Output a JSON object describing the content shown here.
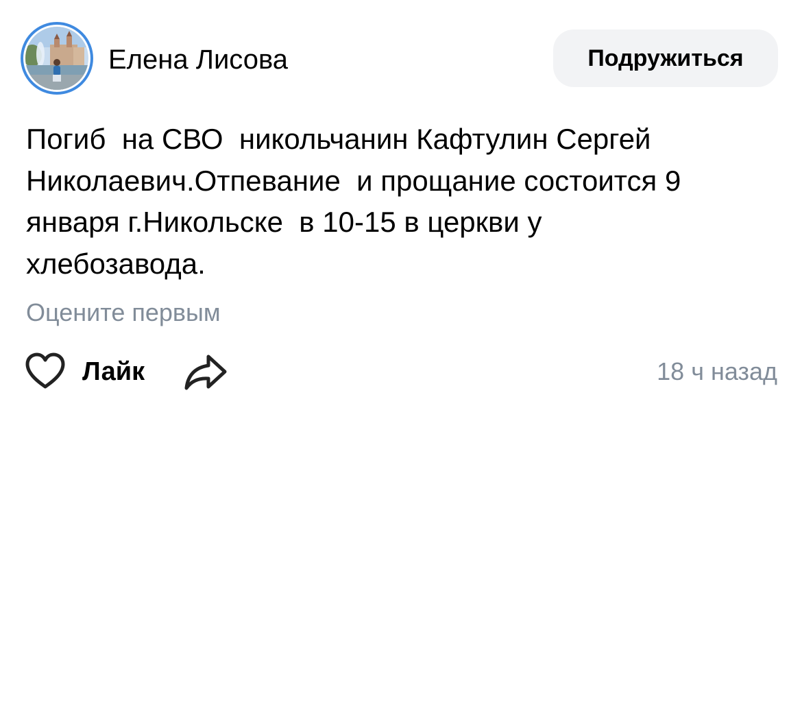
{
  "author": {
    "name": "Елена Лисова",
    "avatar_icon": "user-photo-avatar",
    "avatar_ring_color": "#3f8ae0"
  },
  "header": {
    "befriend_label": "Подружиться"
  },
  "post": {
    "text": "Погиб  на СВО  никольчанин Кафтулин Сергей\nНиколаевич.Отпевание  и прощание состоится 9\nянваря г.Никольске  в 10-15 в церкви у\nхлебозавода.",
    "rate_first_label": "Оцените первым"
  },
  "actions": {
    "like_label": "Лайк",
    "like_icon": "heart-outline-icon",
    "share_icon": "share-arrow-icon",
    "timestamp": "18 ч назад"
  },
  "colors": {
    "text_primary": "#000000",
    "text_secondary": "#818c99",
    "button_bg": "#f2f3f5",
    "accent": "#3f8ae0"
  }
}
